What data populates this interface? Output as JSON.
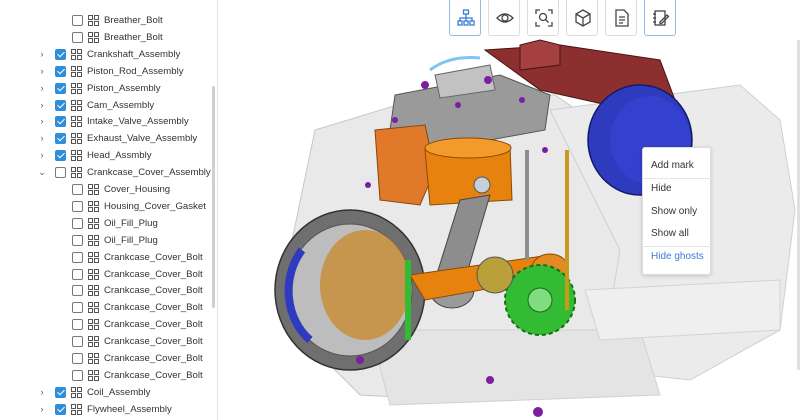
{
  "toolbar": {
    "buttons": [
      {
        "name": "structure-tree-button",
        "icon": "hierarchy-icon",
        "active": true
      },
      {
        "name": "view-button",
        "icon": "eye-icon",
        "active": false
      },
      {
        "name": "zoom-fit-button",
        "icon": "zoom-search-icon",
        "active": false
      },
      {
        "name": "3d-box-button",
        "icon": "cube-icon",
        "active": false
      },
      {
        "name": "document-button",
        "icon": "document-icon",
        "active": false
      },
      {
        "name": "notes-button",
        "icon": "notebook-pen-icon",
        "active": true
      }
    ]
  },
  "tree": {
    "items": [
      {
        "label": "Breather_Bolt",
        "checked": false,
        "expandable": false,
        "expanded": false,
        "indent": 1
      },
      {
        "label": "Breather_Bolt",
        "checked": false,
        "expandable": false,
        "expanded": false,
        "indent": 1
      },
      {
        "label": "Crankshaft_Assembly",
        "checked": true,
        "expandable": true,
        "expanded": false,
        "indent": 0
      },
      {
        "label": "Piston_Rod_Assembly",
        "checked": true,
        "expandable": true,
        "expanded": false,
        "indent": 0
      },
      {
        "label": "Piston_Assembly",
        "checked": true,
        "expandable": true,
        "expanded": false,
        "indent": 0
      },
      {
        "label": "Cam_Assembly",
        "checked": true,
        "expandable": true,
        "expanded": false,
        "indent": 0
      },
      {
        "label": "Intake_Valve_Assembly",
        "checked": true,
        "expandable": true,
        "expanded": false,
        "indent": 0
      },
      {
        "label": "Exhaust_Valve_Assembly",
        "checked": true,
        "expandable": true,
        "expanded": false,
        "indent": 0
      },
      {
        "label": "Head_Assmbly",
        "checked": true,
        "expandable": true,
        "expanded": false,
        "indent": 0
      },
      {
        "label": "Crankcase_Cover_Assembly",
        "checked": false,
        "expandable": true,
        "expanded": true,
        "indent": 0
      },
      {
        "label": "Cover_Housing",
        "checked": false,
        "expandable": false,
        "expanded": false,
        "indent": 1
      },
      {
        "label": "Housing_Cover_Gasket",
        "checked": false,
        "expandable": false,
        "expanded": false,
        "indent": 1
      },
      {
        "label": "Oil_Fill_Plug",
        "checked": false,
        "expandable": false,
        "expanded": false,
        "indent": 1
      },
      {
        "label": "Oil_Fill_Plug",
        "checked": false,
        "expandable": false,
        "expanded": false,
        "indent": 1
      },
      {
        "label": "Crankcase_Cover_Bolt",
        "checked": false,
        "expandable": false,
        "expanded": false,
        "indent": 1
      },
      {
        "label": "Crankcase_Cover_Bolt",
        "checked": false,
        "expandable": false,
        "expanded": false,
        "indent": 1
      },
      {
        "label": "Crankcase_Cover_Bolt",
        "checked": false,
        "expandable": false,
        "expanded": false,
        "indent": 1
      },
      {
        "label": "Crankcase_Cover_Bolt",
        "checked": false,
        "expandable": false,
        "expanded": false,
        "indent": 1
      },
      {
        "label": "Crankcase_Cover_Bolt",
        "checked": false,
        "expandable": false,
        "expanded": false,
        "indent": 1
      },
      {
        "label": "Crankcase_Cover_Bolt",
        "checked": false,
        "expandable": false,
        "expanded": false,
        "indent": 1
      },
      {
        "label": "Crankcase_Cover_Bolt",
        "checked": false,
        "expandable": false,
        "expanded": false,
        "indent": 1
      },
      {
        "label": "Crankcase_Cover_Bolt",
        "checked": false,
        "expandable": false,
        "expanded": false,
        "indent": 1
      },
      {
        "label": "Coil_Assembly",
        "checked": true,
        "expandable": true,
        "expanded": false,
        "indent": 0
      },
      {
        "label": "Flywheel_Assembly",
        "checked": true,
        "expandable": true,
        "expanded": false,
        "indent": 0
      }
    ]
  },
  "context_menu": {
    "items": [
      {
        "label": "Add mark",
        "link": false
      },
      {
        "label": "Hide",
        "link": false
      },
      {
        "label": "Show only",
        "link": false
      },
      {
        "label": "Show all",
        "link": false
      },
      {
        "label": "Hide ghosts",
        "link": true
      }
    ]
  },
  "colors": {
    "accent": "#2d8fdc",
    "link": "#3a7bd5",
    "piston": "#e8820f",
    "head": "#8b2f2f",
    "cam_gear": "#33bb33",
    "flywheel": "#2e3bbf",
    "bolts": "#7a1fa0"
  }
}
